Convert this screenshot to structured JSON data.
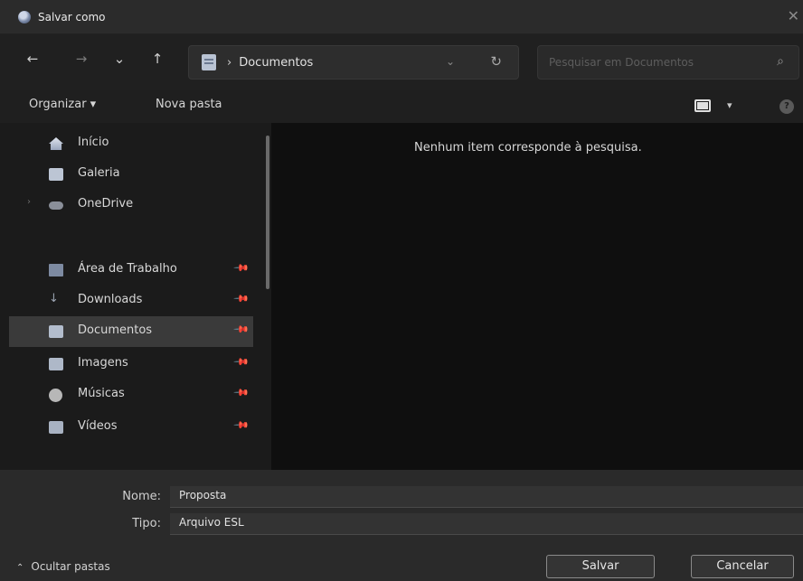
{
  "window": {
    "title": "Salvar como"
  },
  "navigation": {
    "back": "←",
    "forward": "→",
    "recent": "⌄",
    "up": "↑",
    "breadcrumb": "Documentos",
    "breadcrumb_sep": "›",
    "search_placeholder": "Pesquisar em Documentos"
  },
  "toolbar": {
    "organize": "Organizar ▾",
    "new_folder": "Nova pasta",
    "help": "?"
  },
  "sidebar": {
    "items": [
      {
        "label": "Início",
        "icon": "home-icon"
      },
      {
        "label": "Galeria",
        "icon": "gallery-icon"
      },
      {
        "label": "OneDrive",
        "icon": "onedrive-icon"
      },
      {
        "label": "Área de Trabalho",
        "icon": "desktop-icon",
        "pinned": true
      },
      {
        "label": "Downloads",
        "icon": "download-icon",
        "pinned": true
      },
      {
        "label": "Documentos",
        "icon": "documents-icon",
        "pinned": true,
        "selected": true
      },
      {
        "label": "Imagens",
        "icon": "images-icon",
        "pinned": true
      },
      {
        "label": "Músicas",
        "icon": "music-icon",
        "pinned": true
      },
      {
        "label": "Vídeos",
        "icon": "videos-icon",
        "pinned": true
      }
    ]
  },
  "main": {
    "empty_message": "Nenhum item corresponde à pesquisa."
  },
  "form": {
    "name_label": "Nome:",
    "name_value": "Proposta",
    "type_label": "Tipo:",
    "type_value": "Arquivo ESL"
  },
  "footer": {
    "hide_folders": "Ocultar pastas",
    "save_button": "Salvar",
    "cancel_button": "Cancelar"
  },
  "colors": {
    "background": "#1b1b1b",
    "selected_item": "#3a3a3a",
    "bottom_panel": "#2a2a2a"
  }
}
